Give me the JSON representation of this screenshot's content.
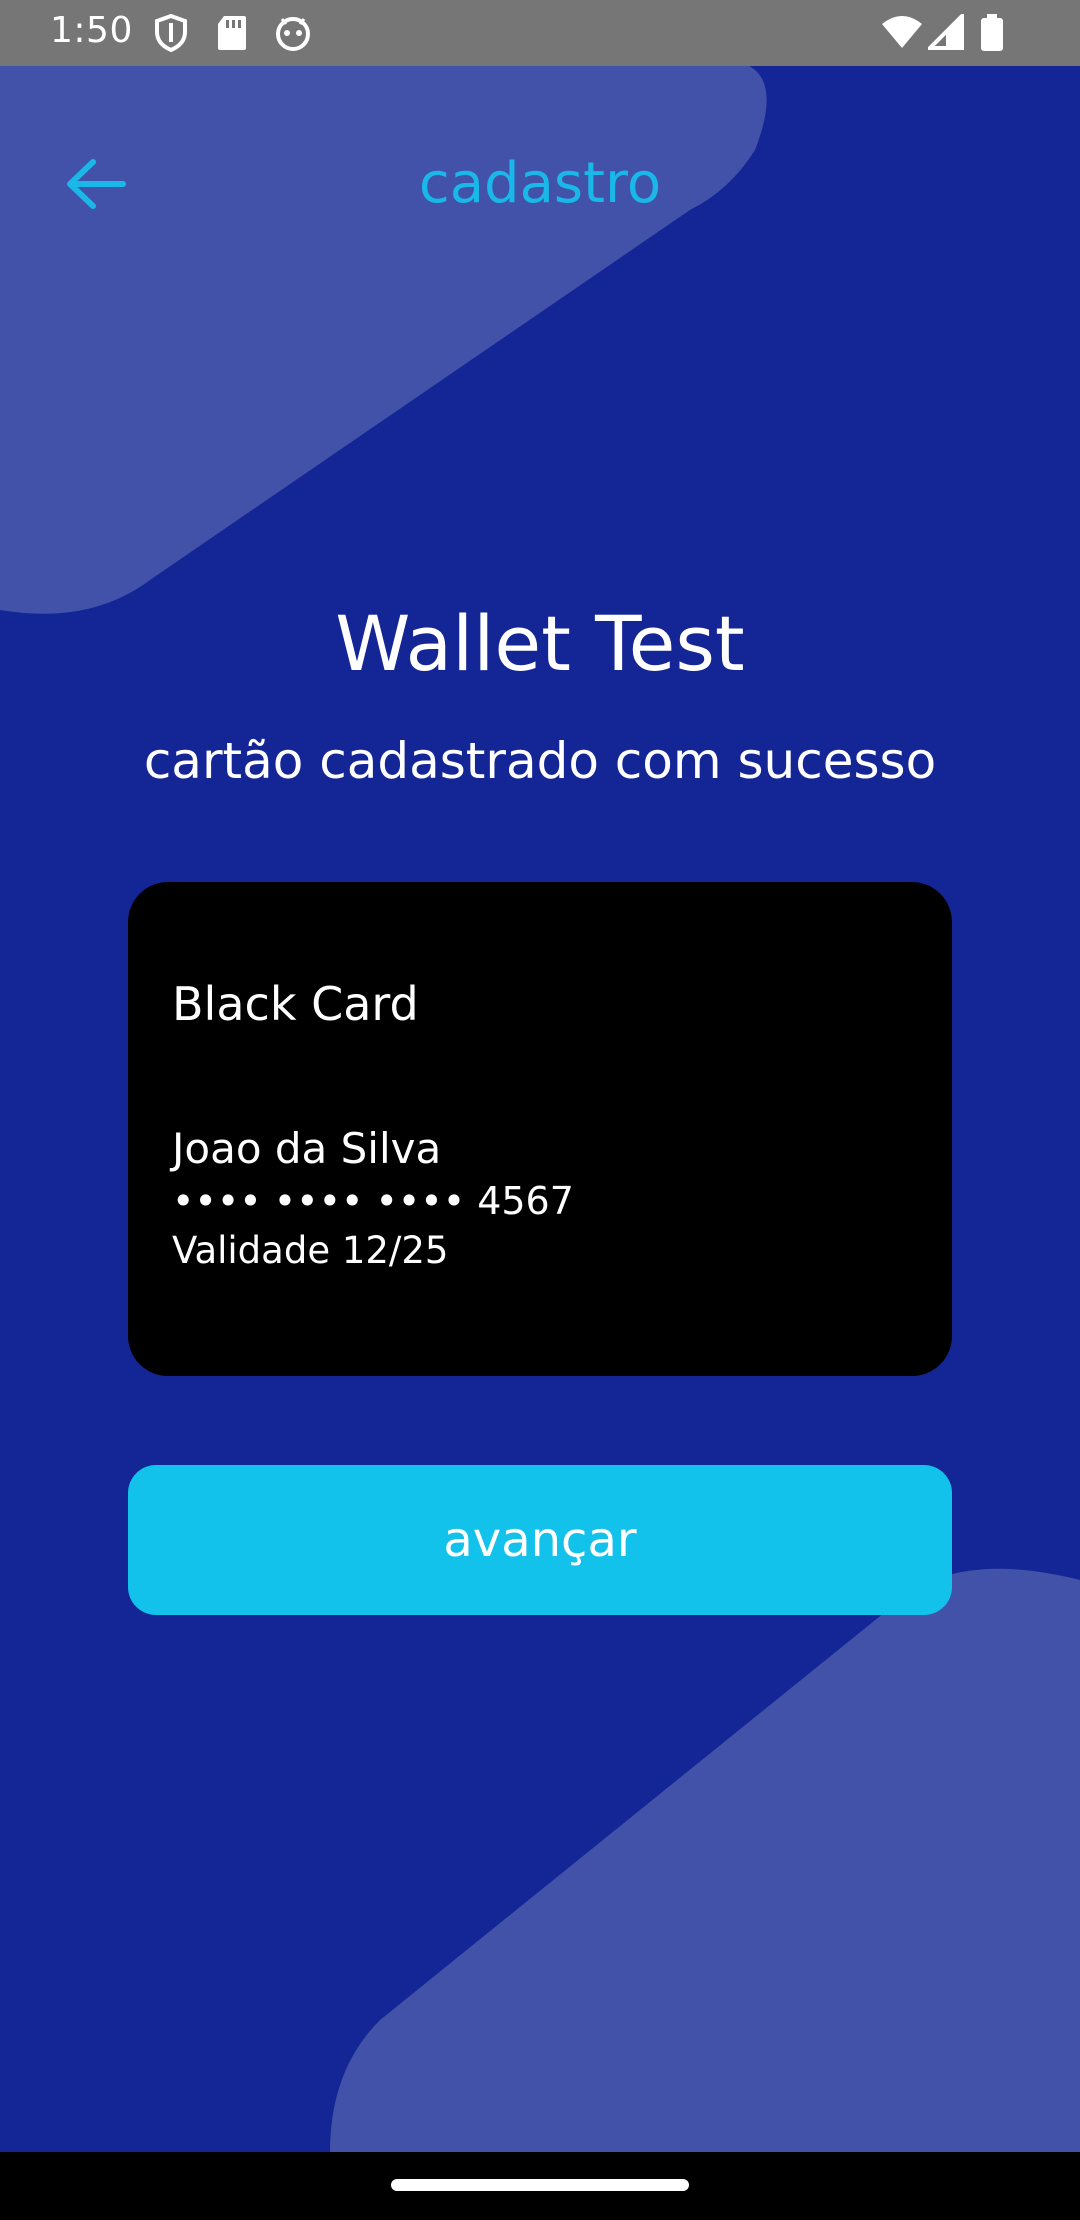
{
  "status_bar": {
    "time": "1:50",
    "left_icons": [
      "shield-icon",
      "sd-card-icon",
      "android-debug-icon"
    ],
    "right_icons": [
      "wifi-icon",
      "cell-signal-icon",
      "battery-icon"
    ]
  },
  "top_bar": {
    "back_icon": "arrow-left-icon",
    "title": "cadastro"
  },
  "app_title": "Wallet Test",
  "subtitle": "cartão cadastrado com sucesso",
  "card": {
    "name": "Black Card",
    "holder": "Joao da Silva",
    "number": "•••• •••• •••• 4567",
    "validity": "Validade 12/25",
    "color": "#000000"
  },
  "primary_button": {
    "label": "avançar"
  },
  "colors": {
    "background": "#142596",
    "decor_shape": "#4152a8",
    "accent": "#1ab8e8",
    "button": "#12c2ea",
    "status_bar": "#767676"
  }
}
